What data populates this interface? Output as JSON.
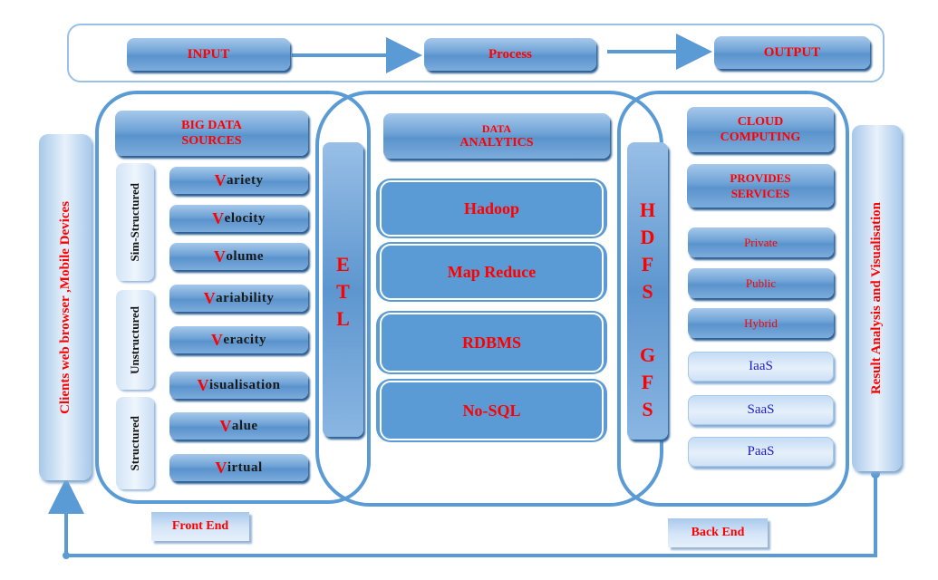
{
  "flow": {
    "input": "INPUT",
    "process": "Process",
    "output": "OUTPUT"
  },
  "front_end": {
    "header": "BIG DATA SOURCES",
    "header_line1": "BIG DATA",
    "header_line2": "SOURCES",
    "categories": [
      {
        "label": "Sim-Structured"
      },
      {
        "label": "Unstructured"
      },
      {
        "label": "Structured"
      }
    ],
    "vs": [
      {
        "initial": "V",
        "rest": "ariety"
      },
      {
        "initial": "V",
        "rest": "elocity"
      },
      {
        "initial": "V",
        "rest": "olume"
      },
      {
        "initial": "V",
        "rest": "ariability"
      },
      {
        "initial": "V",
        "rest": "eracity"
      },
      {
        "initial": "V",
        "rest": "isualisation"
      },
      {
        "initial": "V",
        "rest": "alue"
      },
      {
        "initial": "V",
        "rest": "irtual"
      }
    ],
    "label": "Front End"
  },
  "etl": {
    "letters": [
      "E",
      "T",
      "L"
    ]
  },
  "analytics": {
    "header_line1": "DATA",
    "header_line2": "ANALYTICS",
    "items": [
      "Hadoop",
      "Map Reduce",
      "RDBMS",
      "No-SQL"
    ]
  },
  "storage": {
    "hdfs": [
      "H",
      "D",
      "F",
      "S"
    ],
    "gfs": [
      "G",
      "F",
      "S"
    ]
  },
  "back_end": {
    "cloud_line1": "CLOUD",
    "cloud_line2": "COMPUTING",
    "services_line1": "PROVIDES",
    "services_line2": "SERVICES",
    "deployment": [
      "Private",
      "Public",
      "Hybrid"
    ],
    "service_models": [
      "IaaS",
      "SaaS",
      "PaaS"
    ],
    "label": "Back End"
  },
  "clients": "Clients  web browser ,Mobile Devices",
  "results": "Result Analysis and Visualisation",
  "colors": {
    "accent_blue": "#5b9bd5",
    "label_red": "#ff0000",
    "service_blue": "#1a1ad0"
  }
}
